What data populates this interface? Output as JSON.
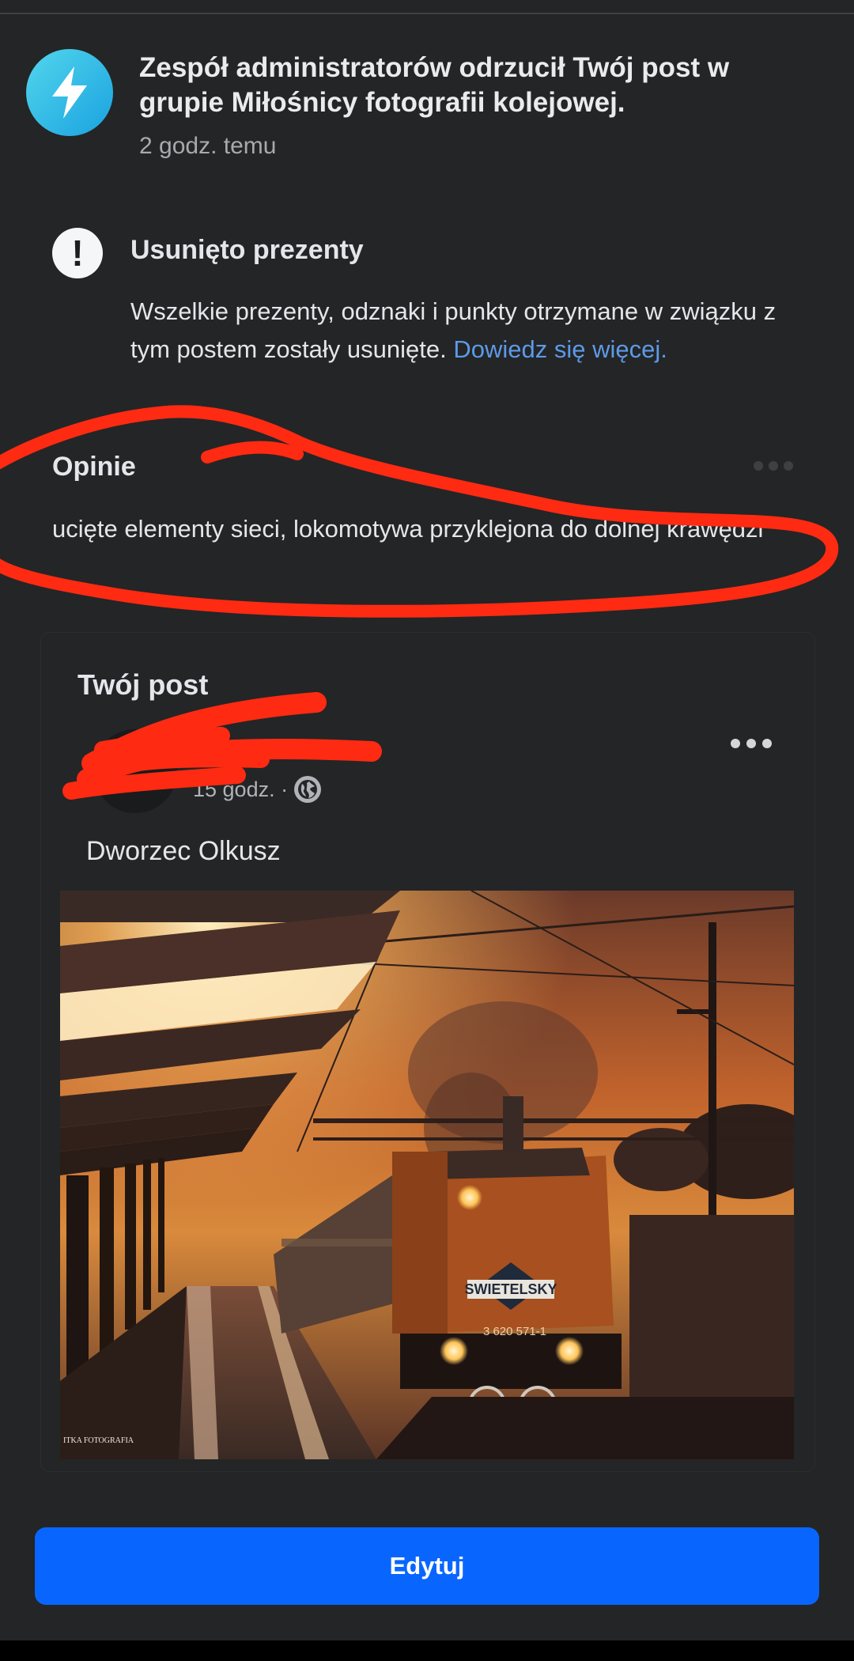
{
  "notification": {
    "icon": "lightning-bolt-icon",
    "title": "Zespół administratorów odrzucił Twój post w grupie Miłośnicy fotografii kolejowej.",
    "time": "2 godz. temu"
  },
  "gifts": {
    "icon": "exclamation-icon",
    "title": "Usunięto prezenty",
    "body": "Wszelkie prezenty, odznaki i punkty otrzymane w związku z tym postem zostały usunięte.",
    "link": "Dowiedz się więcej."
  },
  "feedback": {
    "title": "Opinie",
    "body": "ucięte elementy sieci, lokomotywa przyklejona do dolnej krawędzi"
  },
  "post": {
    "heading": "Twój post",
    "time": "15 godz.",
    "separator": "·",
    "audience_icon": "globe-icon",
    "text": "Dworzec Olkusz",
    "photo": {
      "loco_brand": "SWIETELSKY",
      "loco_number": "3 620 571-1",
      "watermark": "ITKA FOTOGRAFIA"
    }
  },
  "actions": {
    "edit_label": "Edytuj"
  },
  "colors": {
    "background": "#242526",
    "link": "#5d9ae8",
    "primary_button": "#0866ff",
    "scribble": "#ff2a12"
  }
}
